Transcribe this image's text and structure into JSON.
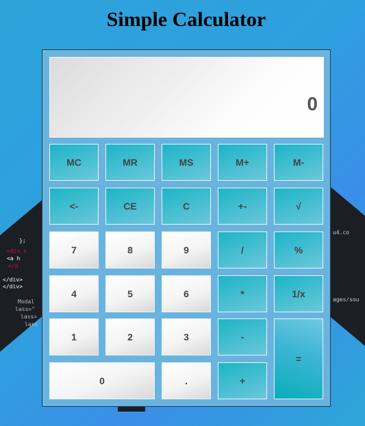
{
  "title": "Simple Calculator",
  "display": {
    "value": "0"
  },
  "keys": {
    "mc": "MC",
    "mr": "MR",
    "ms": "MS",
    "mplus": "M+",
    "mminus": "M-",
    "backspace": "<-",
    "ce": "CE",
    "c": "C",
    "sign": "+-",
    "sqrt": "√",
    "seven": "7",
    "eight": "8",
    "nine": "9",
    "divide": "/",
    "percent": "%",
    "four": "4",
    "five": "5",
    "six": "6",
    "multiply": "*",
    "reciprocal": "1/x",
    "one": "1",
    "two": "2",
    "three": "3",
    "subtract": "-",
    "equals": "=",
    "zero": "0",
    "decimal": ".",
    "add": "+"
  },
  "colors": {
    "accent": "#1cb5c6",
    "panel": "#6ab3df",
    "background": "#2ea3d9"
  },
  "background_code": {
    "left": [
      "};",
      "<div s",
      "<a h",
      "</d",
      "</div>",
      "</div>",
      "Modal",
      "lass=\"",
      "lass=",
      "lass"
    ],
    "right": [
      "u4.co",
      "ages/sou"
    ]
  }
}
